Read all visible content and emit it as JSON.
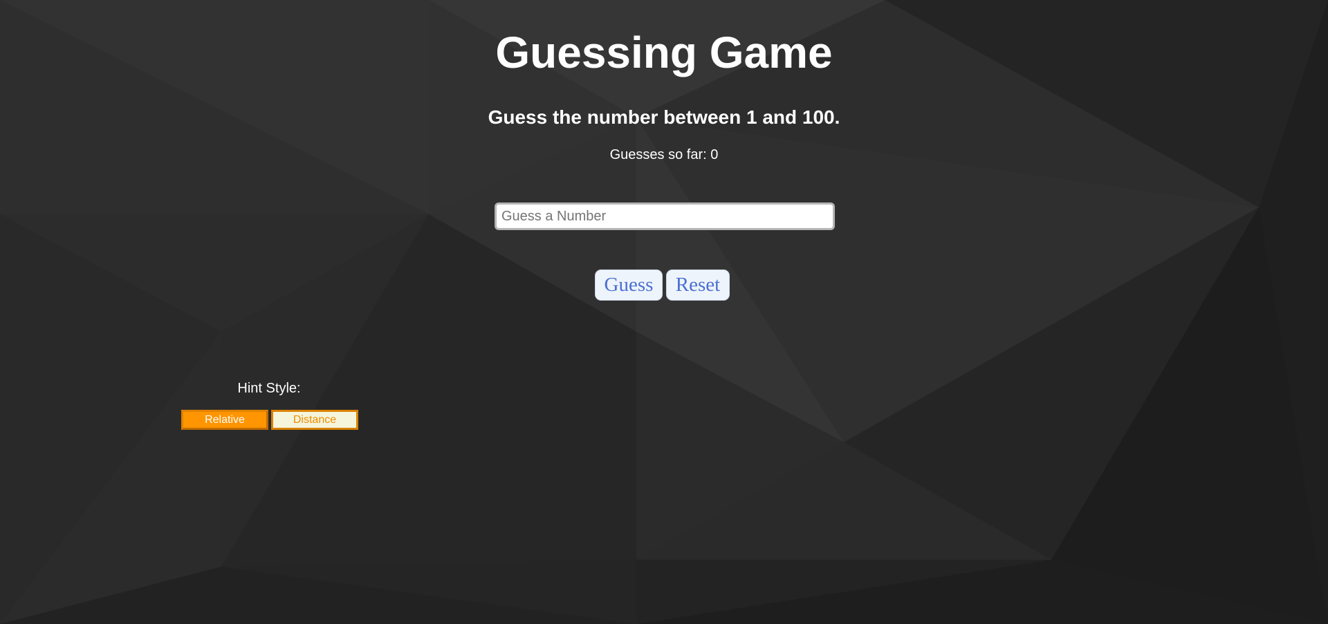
{
  "game": {
    "title": "Guessing Game",
    "instructions": "Guess the number between 1 and 100.",
    "guess_counter": "Guesses so far: 0"
  },
  "input": {
    "value": "",
    "placeholder": "Guess a Number"
  },
  "buttons": {
    "guess_label": "Guess",
    "reset_label": "Reset"
  },
  "hint": {
    "label": "Hint Style:",
    "options": [
      "Relative",
      "Distance"
    ],
    "selected": "Relative"
  },
  "colors": {
    "background": "#2a2a2a",
    "accent_orange": "#ff9500",
    "button_text_blue": "#4a6fd1",
    "distance_bg": "#f5f5dc"
  }
}
